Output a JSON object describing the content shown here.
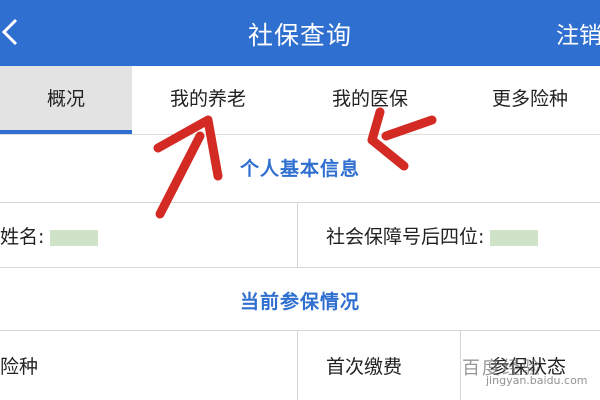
{
  "header": {
    "title": "社保查询",
    "logout_label": "注销"
  },
  "tabs": [
    {
      "label": "概况",
      "active": true
    },
    {
      "label": "我的养老",
      "active": false
    },
    {
      "label": "我的医保",
      "active": false
    },
    {
      "label": "更多险种",
      "active": false
    }
  ],
  "basic_info": {
    "title": "个人基本信息",
    "name_label": "姓名:",
    "ssn_label": "社会保障号后四位:"
  },
  "insurance": {
    "title": "当前参保情况",
    "columns": [
      "险种",
      "首次缴费",
      "参保状态"
    ]
  },
  "watermark": {
    "text": "百度经验",
    "url": "jingyan.baidu.com"
  },
  "colors": {
    "primary": "#2f6fd0",
    "annotation_arrow": "#d42a24"
  }
}
